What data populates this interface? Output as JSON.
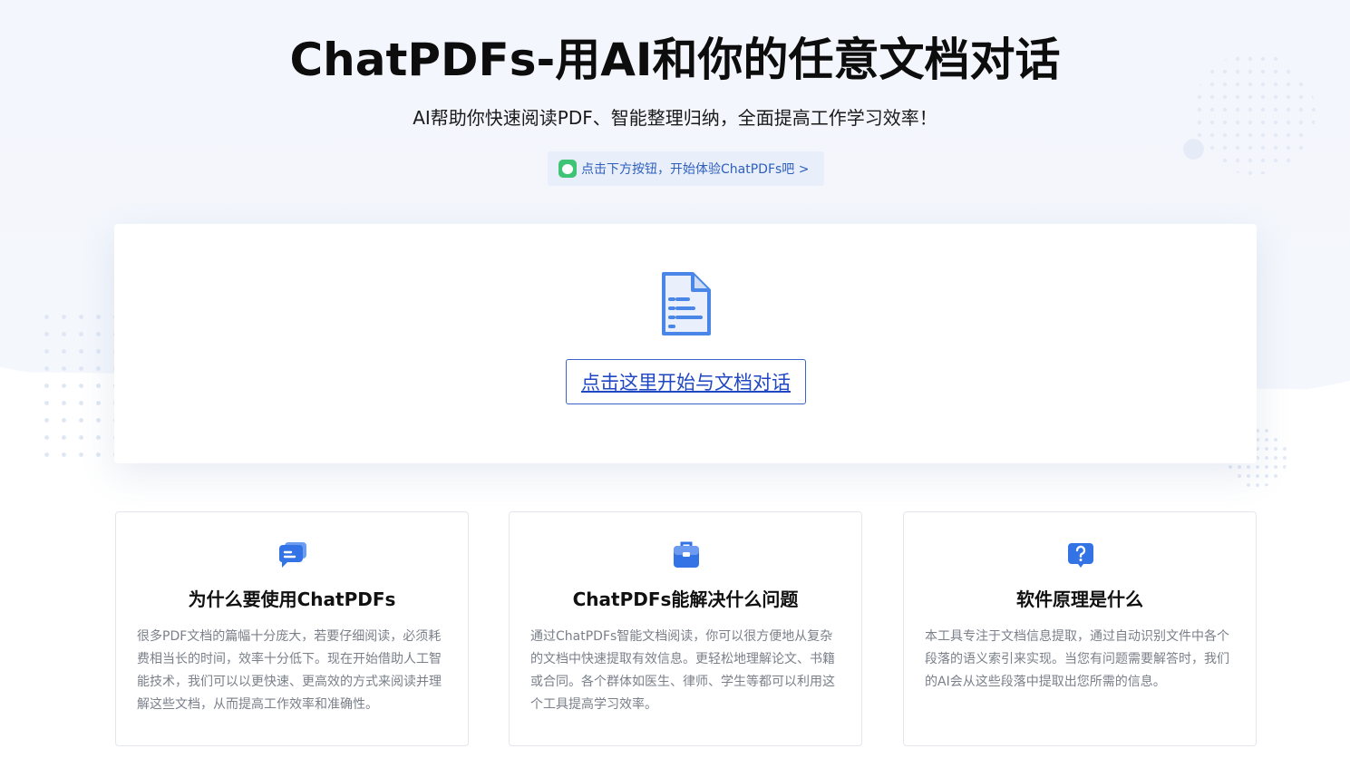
{
  "header": {
    "title": "ChatPDFs-用AI和你的任意文档对话",
    "subtitle": "AI帮助你快速阅读PDF、智能整理归纳，全面提高工作学习效率！",
    "hint": "点击下方按钮，开始体验ChatPDFs吧 >"
  },
  "upload": {
    "icon": "document-icon",
    "button_label": "点击这里开始与文档对话"
  },
  "features": [
    {
      "icon": "chat-bubbles-icon",
      "title": "为什么要使用ChatPDFs",
      "text": "很多PDF文档的篇幅十分庞大，若要仔细阅读，必须耗费相当长的时间，效率十分低下。现在开始借助人工智能技术，我们可以以更快速、更高效的方式来阅读并理解这些文档，从而提高工作效率和准确性。"
    },
    {
      "icon": "briefcase-icon",
      "title": "ChatPDFs能解决什么问题",
      "text": "通过ChatPDFs智能文档阅读，你可以很方便地从复杂的文档中快速提取有效信息。更轻松地理解论文、书籍或合同。各个群体如医生、律师、学生等都可以利用这个工具提高学习效率。"
    },
    {
      "icon": "question-bubble-icon",
      "title": "软件原理是什么",
      "text": "本工具专注于文档信息提取，通过自动识别文件中各个段落的语义索引来实现。当您有问题需要解答时，我们的AI会从这些段落中提取出您所需的信息。"
    }
  ],
  "colors": {
    "accent": "#4a86e8",
    "button_border": "#3a63c9",
    "hint_bg": "#e8eefa",
    "hint_icon": "#3ec474"
  }
}
